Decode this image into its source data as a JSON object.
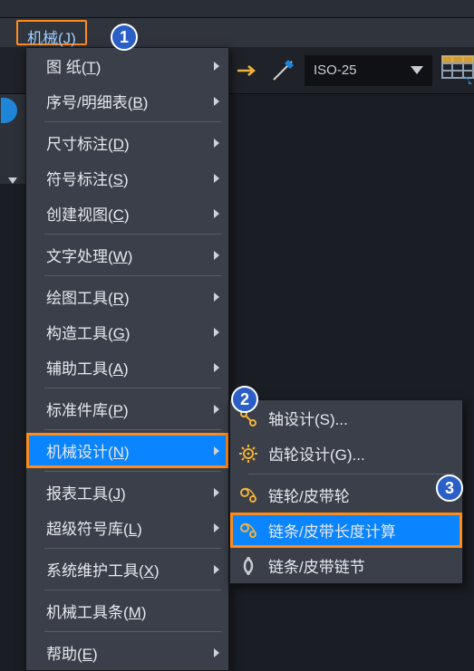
{
  "menubar": {
    "top_item": "机械(J)"
  },
  "toolbar": {
    "dim_style": "ISO-25"
  },
  "main_menu": {
    "items": [
      {
        "label": "图   纸",
        "hotkey": "T",
        "arrow": true,
        "spaced": true
      },
      {
        "label": "序号/明细表",
        "hotkey": "B",
        "arrow": true,
        "sep_after": true
      },
      {
        "label": "尺寸标注",
        "hotkey": "D",
        "arrow": true
      },
      {
        "label": "符号标注",
        "hotkey": "S",
        "arrow": true
      },
      {
        "label": "创建视图",
        "hotkey": "C",
        "arrow": true,
        "sep_after": true
      },
      {
        "label": "文字处理",
        "hotkey": "W",
        "arrow": true,
        "sep_after": true
      },
      {
        "label": "绘图工具",
        "hotkey": "R",
        "arrow": true
      },
      {
        "label": "构造工具",
        "hotkey": "G",
        "arrow": true
      },
      {
        "label": "辅助工具",
        "hotkey": "A",
        "arrow": true,
        "sep_after": true
      },
      {
        "label": "标准件库",
        "hotkey": "P",
        "arrow": true,
        "sep_after": true
      },
      {
        "label": "机械设计",
        "hotkey": "N",
        "arrow": true,
        "selected": true,
        "boxed": true,
        "sep_after": true
      },
      {
        "label": "报表工具",
        "hotkey": "J",
        "arrow": true
      },
      {
        "label": "超级符号库",
        "hotkey": "L",
        "arrow": true,
        "sep_after": true
      },
      {
        "label": "系统维护工具",
        "hotkey": "X",
        "arrow": true,
        "sep_after": true
      },
      {
        "label": "机械工具条",
        "hotkey": "M",
        "arrow": false,
        "sep_after": true
      },
      {
        "label": "帮助",
        "hotkey": "E",
        "arrow": true
      }
    ]
  },
  "sub_menu": {
    "items": [
      {
        "icon": "shaft-icon",
        "label": "轴设计(S)..."
      },
      {
        "icon": "gear-icon",
        "label": "齿轮设计(G)...",
        "sep_after": true
      },
      {
        "icon": "sprocket-icon",
        "label": "链轮/皮带轮"
      },
      {
        "icon": "chain-length-icon",
        "label": "链条/皮带长度计算",
        "selected": true,
        "boxed": true
      },
      {
        "icon": "chain-link-icon",
        "label": "链条/皮带链节"
      }
    ]
  },
  "badges": {
    "b1": "1",
    "b2": "2",
    "b3": "3"
  }
}
